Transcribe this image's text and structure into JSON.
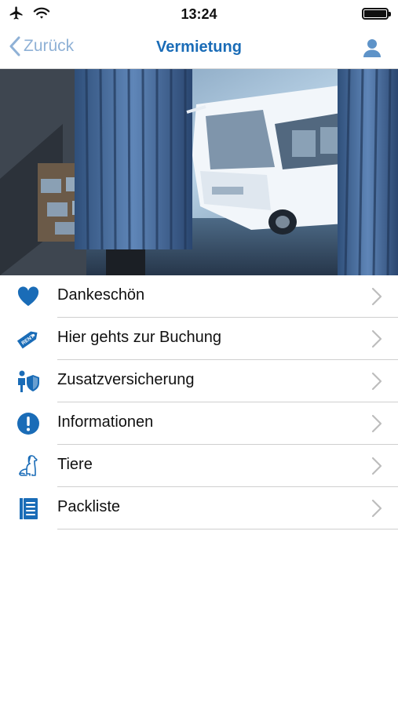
{
  "status_bar": {
    "time": "13:24"
  },
  "nav": {
    "back_label": "Zurück",
    "title": "Vermietung"
  },
  "colors": {
    "brand_blue": "#1a6cb7",
    "back_blue": "#8fb1d6",
    "chevron": "#bdbdbd"
  },
  "menu": [
    {
      "label": "Dankeschön",
      "icon": "heart-icon"
    },
    {
      "label": "Hier gehts zur Buchung",
      "icon": "rent-tag-icon",
      "icon_text": "RENT"
    },
    {
      "label": "Zusatzversicherung",
      "icon": "insurance-shield-icon"
    },
    {
      "label": "Informationen",
      "icon": "info-exclamation-icon"
    },
    {
      "label": "Tiere",
      "icon": "dog-icon"
    },
    {
      "label": "Packliste",
      "icon": "checklist-icon"
    }
  ]
}
